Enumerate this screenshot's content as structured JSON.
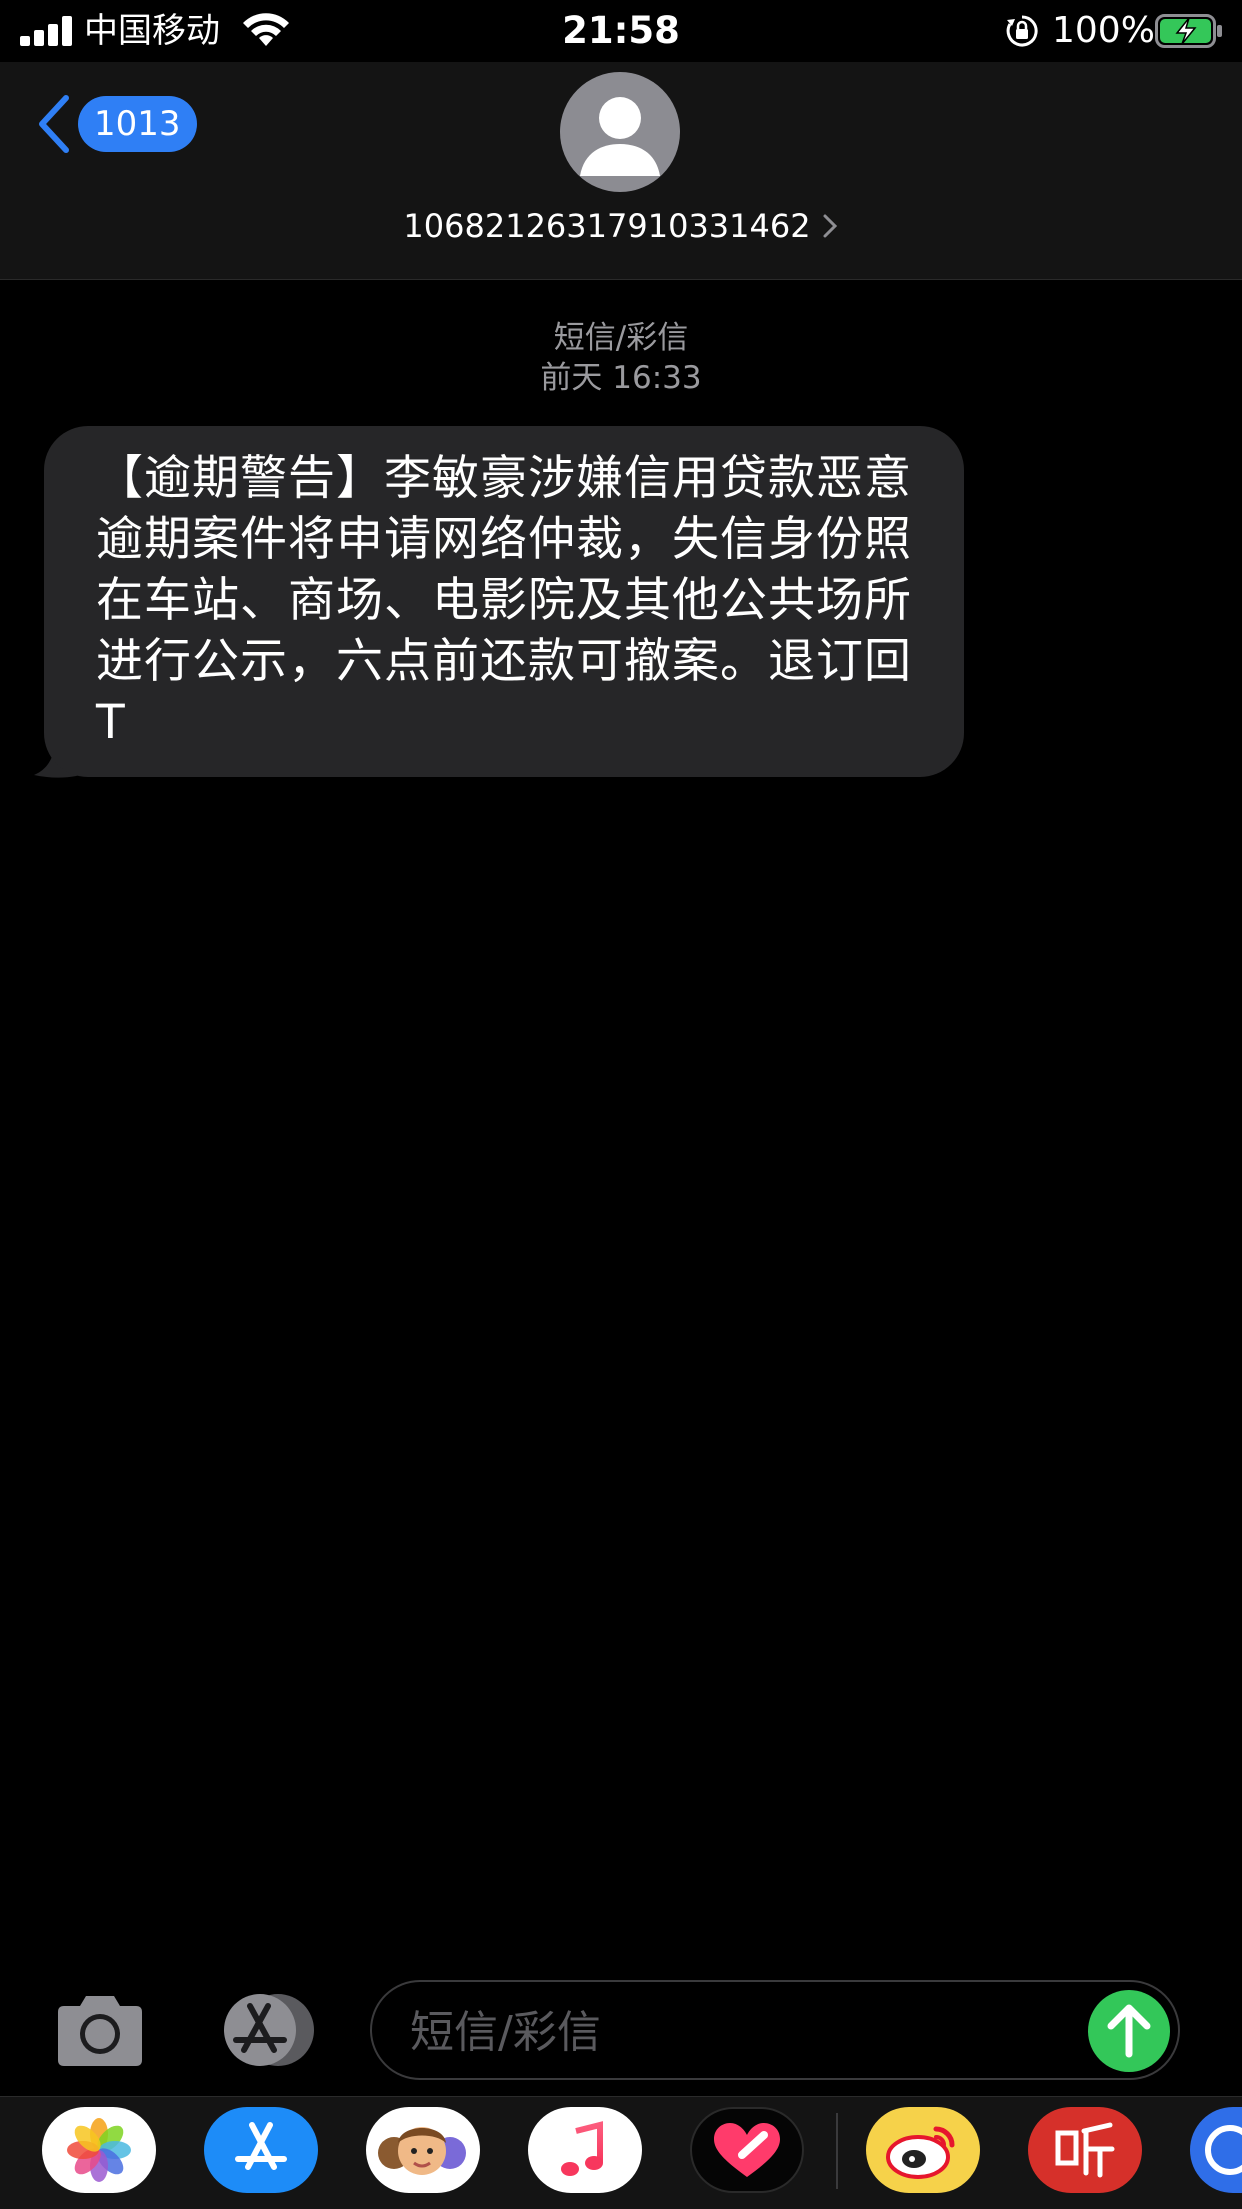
{
  "status_bar": {
    "carrier": "中国移动",
    "time": "21:58",
    "battery_percent": "100%"
  },
  "header": {
    "back_badge": "1013",
    "contact_number": "10682126317910331462"
  },
  "conversation": {
    "message_type": "短信/彩信",
    "timestamp": "前天 16:33",
    "messages": [
      {
        "direction": "incoming",
        "text": "【逾期警告】李敏豪涉嫌信用贷款恶意逾期案件将申请网络仲裁，失信身份照在车站、商场、电影院及其他公共场所进行公示，六点前还款可撤案。退订回 T"
      }
    ]
  },
  "composer": {
    "placeholder": "短信/彩信"
  },
  "app_drawer": {
    "apps": [
      "photos-icon",
      "app-store-icon",
      "memoji-icon",
      "music-icon",
      "digital-touch-icon",
      "weibo-icon",
      "listen-icon",
      "partial-app-icon"
    ]
  },
  "colors": {
    "accent_blue": "#2f7ff5",
    "send_green": "#33c759",
    "bubble_gray": "#262628"
  }
}
